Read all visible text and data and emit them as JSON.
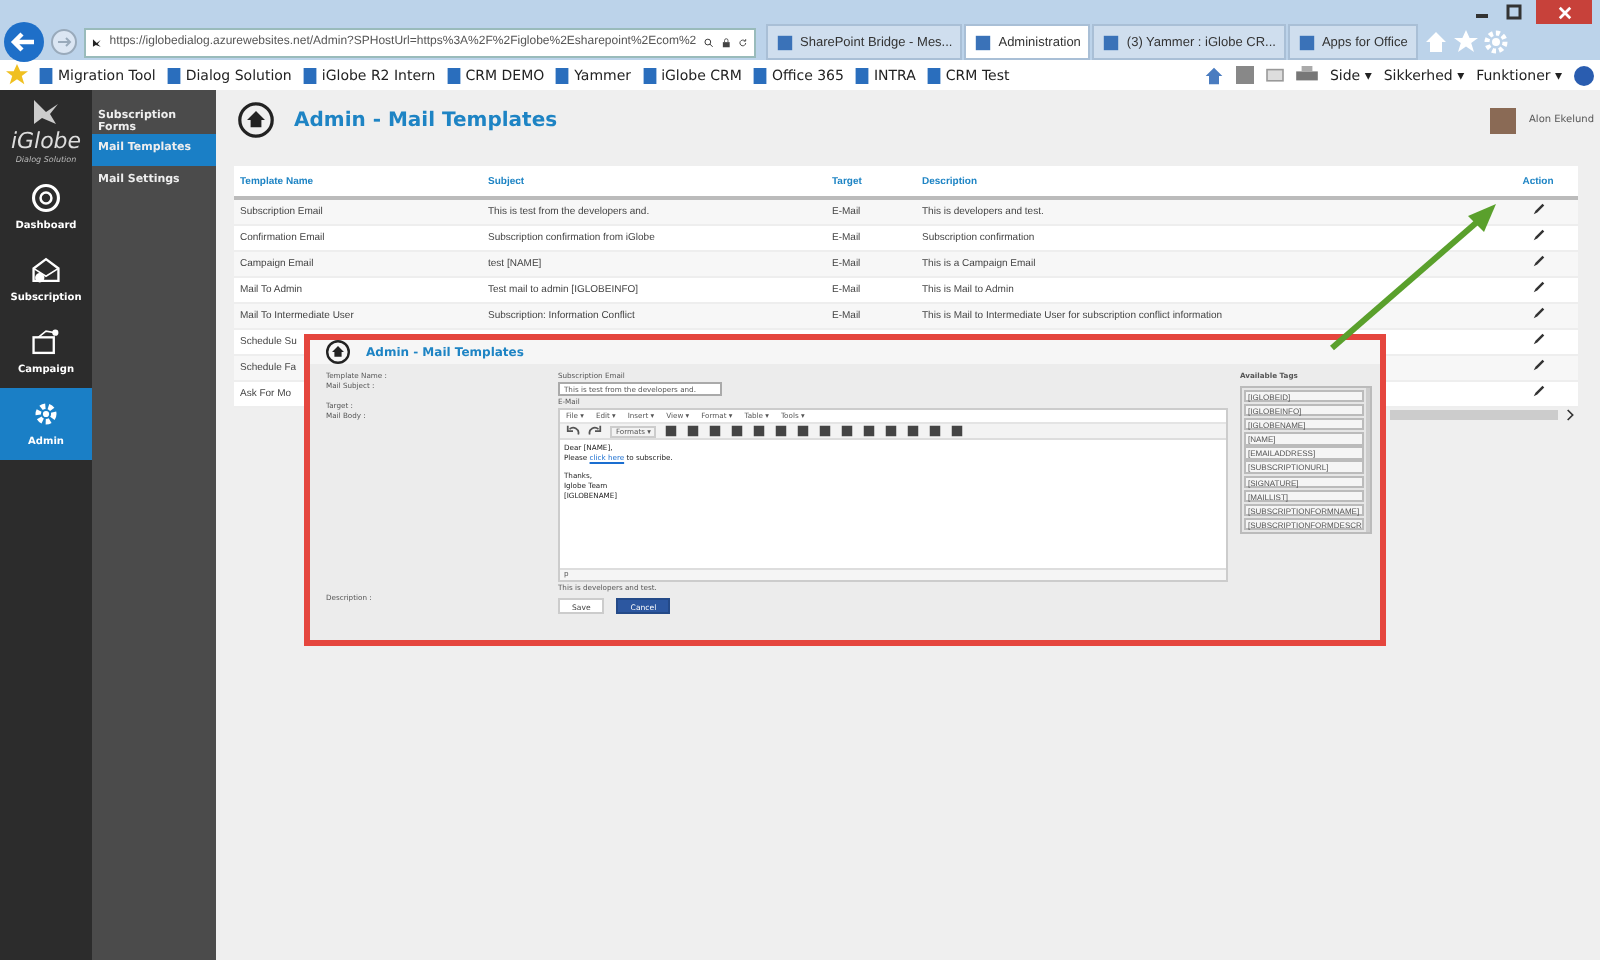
{
  "browser": {
    "address": "https://iglobedialog.azurewebsites.net/Admin?SPHostUrl=https%3A%2F%2Figlobe%2Esharepoint%2Ecom%2",
    "tabs": [
      {
        "title": "SharePoint Bridge - Mes...",
        "selected": false
      },
      {
        "title": "Administration",
        "selected": true
      },
      {
        "title": "(3) Yammer : iGlobe CR...",
        "selected": false
      },
      {
        "title": "Apps for Office",
        "selected": false
      }
    ],
    "favorites": [
      "Migration Tool",
      "Dialog Solution",
      "iGlobe R2 Intern",
      "CRM DEMO",
      "Yammer",
      "iGlobe CRM",
      "Office 365",
      "INTRA",
      "CRM Test"
    ],
    "commands": [
      "Side ▾",
      "Sikkerhed ▾",
      "Funktioner ▾"
    ]
  },
  "sidebar": {
    "logo": "iGlobe",
    "tagline": "Dialog Solution",
    "items": [
      {
        "label": "Dashboard",
        "selected": false
      },
      {
        "label": "Subscription",
        "selected": false
      },
      {
        "label": "Campaign",
        "selected": false
      },
      {
        "label": "Admin",
        "selected": true
      }
    ]
  },
  "subnav": [
    {
      "label": "Subscription Forms",
      "selected": false
    },
    {
      "label": "Mail Templates",
      "selected": true
    },
    {
      "label": "Mail Settings",
      "selected": false
    }
  ],
  "header": {
    "title": "Admin - Mail Templates",
    "user": "Alon Ekelund"
  },
  "table": {
    "columns": [
      "Template Name",
      "Subject",
      "Target",
      "Description",
      "Action"
    ],
    "rows": [
      [
        "Subscription Email",
        "This is test from the developers and.",
        "E-Mail",
        "This is developers and test."
      ],
      [
        "Confirmation Email",
        "Subscription confirmation from iGlobe",
        "E-Mail",
        "Subscription confirmation"
      ],
      [
        "Campaign Email",
        "test [NAME]",
        "E-Mail",
        "This is a Campaign Email"
      ],
      [
        "Mail To Admin",
        "Test mail to admin [IGLOBEINFO]",
        "E-Mail",
        "This is Mail to Admin"
      ],
      [
        "Mail To Intermediate User",
        "Subscription: Information Conflict",
        "E-Mail",
        "This is Mail to Intermediate User for subscription conflict information"
      ],
      [
        "Schedule Su"
      ],
      [
        "Schedule Fa"
      ],
      [
        "Ask For Mo"
      ]
    ]
  },
  "inset": {
    "title": "Admin - Mail Templates",
    "labels": [
      "Template Name :",
      "Mail Subject :",
      "Target :",
      "Mail Body :",
      "Description :"
    ],
    "template_name": "Subscription Email",
    "mail_subject": "This is test from the developers and.",
    "target": "E-Mail",
    "editor_menus": [
      "File ▾",
      "Edit ▾",
      "Insert ▾",
      "View ▾",
      "Format ▾",
      "Table ▾",
      "Tools ▾"
    ],
    "formats": "Formats ▾",
    "body": {
      "greeting": "Dear [NAME],",
      "line_before": "Please",
      "link": "click here",
      "line_after": "to subscribe.",
      "closing": [
        "Thanks,",
        "Iglobe Team",
        "[IGLOBENAME]"
      ]
    },
    "status_path": "p",
    "description": "This is developers and test.",
    "tags_title": "Available Tags",
    "tags": [
      "[IGLOBEID]",
      "[IGLOBEINFO]",
      "[IGLOBENAME]",
      "[NAME]",
      "[EMAILADDRESS]",
      "[SUBSCRIPTIONURL]",
      "[SIGNATURE]",
      "[MAILLIST]",
      "[SUBSCRIPTIONFORMNAME]",
      "[SUBSCRIPTIONFORMDESCR"
    ],
    "buttons": [
      "Save",
      "Cancel"
    ]
  }
}
